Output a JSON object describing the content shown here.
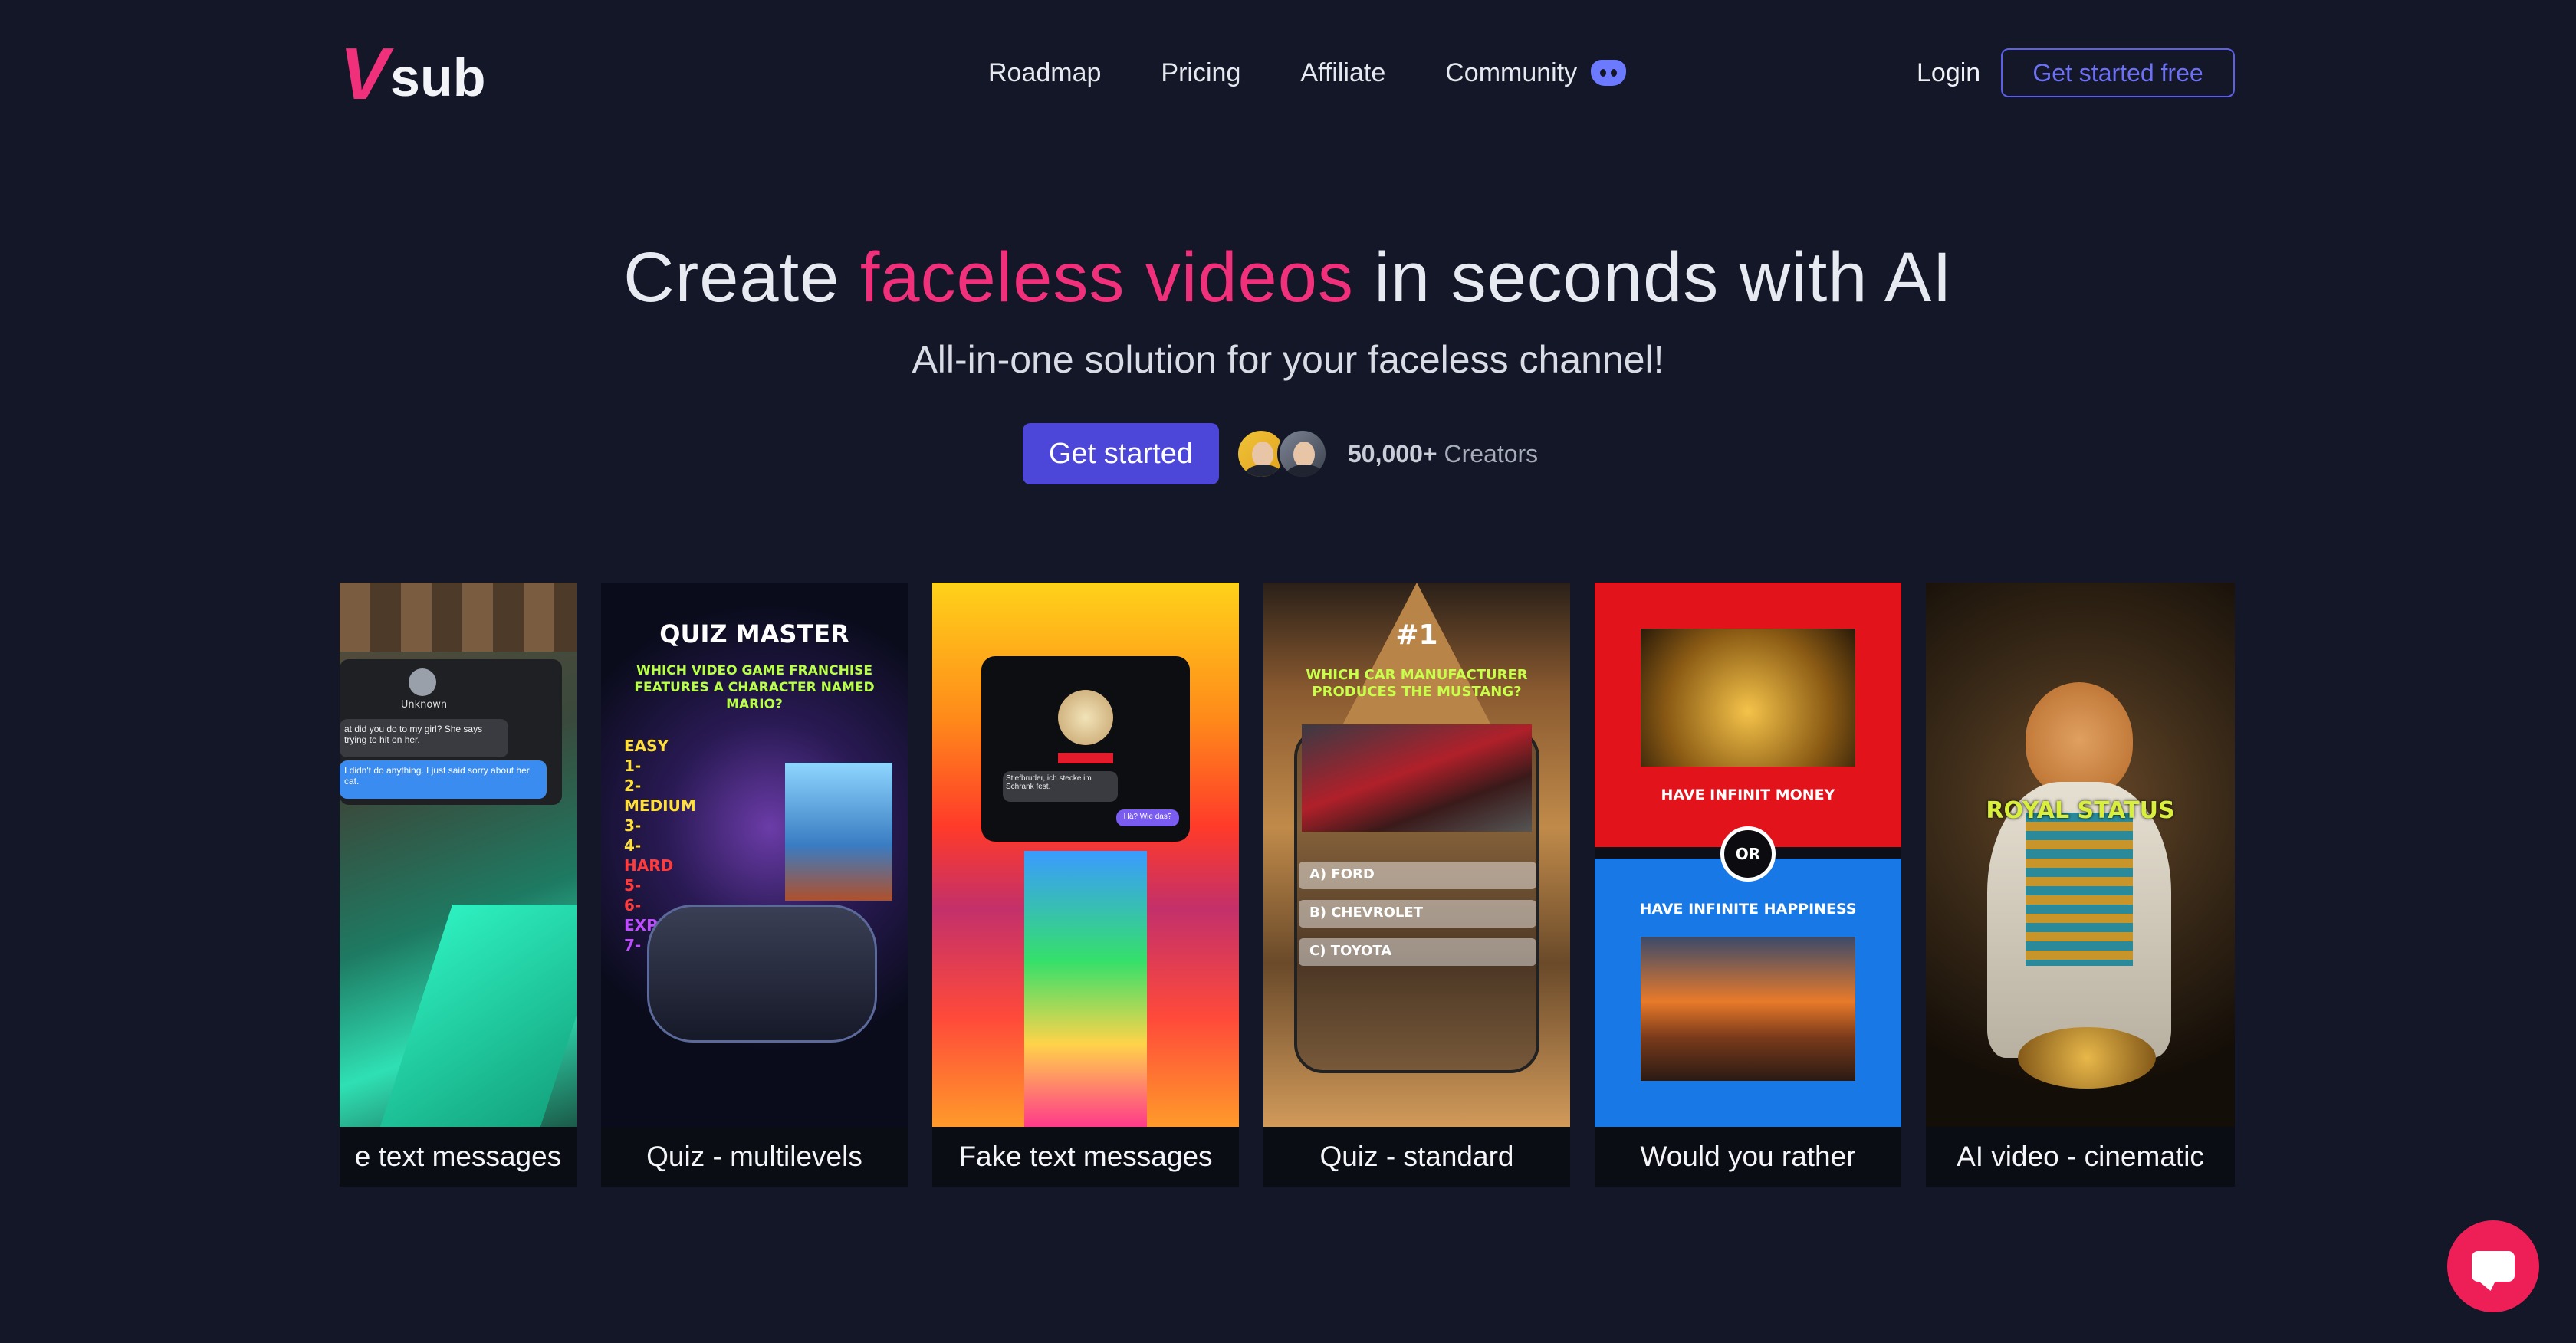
{
  "brand": {
    "logo_v": "V",
    "logo_rest": "sub"
  },
  "nav": {
    "items": [
      {
        "label": "Roadmap"
      },
      {
        "label": "Pricing"
      },
      {
        "label": "Affiliate"
      },
      {
        "label": "Community"
      }
    ],
    "login": "Login",
    "cta": "Get started free"
  },
  "hero": {
    "title_pre": "Create ",
    "title_highlight": "faceless videos",
    "title_post": " in seconds with AI",
    "subtitle": "All-in-one solution for your faceless channel!",
    "button": "Get started",
    "creators_count": "50,000+",
    "creators_label": "Creators"
  },
  "cards": [
    {
      "caption": "e text messages",
      "chat_name": "Unknown",
      "msg1": "at did you do to my girl? She says trying to hit on her.",
      "msg2": "I didn't do anything. I just said sorry about her cat."
    },
    {
      "caption": "Quiz - multilevels",
      "heading": "QUIZ MASTER",
      "question": "WHICH VIDEO GAME FRANCHISE FEATURES A CHARACTER NAMED MARIO?",
      "levels": [
        "EASY",
        "1-",
        "2-",
        "MEDIUM",
        "3-",
        "4-",
        "HARD",
        "5-",
        "6-",
        "EXPERT",
        "7-"
      ]
    },
    {
      "caption": "Fake text messages",
      "msg1": "Stiefbruder, ich stecke im Schrank fest.",
      "msg2": "Hä? Wie das?"
    },
    {
      "caption": "Quiz - standard",
      "number": "#1",
      "question": "WHICH CAR MANUFACTURER PRODUCES THE MUSTANG?",
      "options": [
        "A) FORD",
        "B) CHEVROLET",
        "C) TOYOTA"
      ]
    },
    {
      "caption": "Would you rather",
      "option_a": "HAVE INFINIT MONEY",
      "or": "OR",
      "option_b": "HAVE INFINITE HAPPINESS"
    },
    {
      "caption": "AI video - cinematic",
      "overlay": "ROYAL STATUS"
    }
  ],
  "colors": {
    "accent": "#f0307a",
    "primary": "#4c46d9",
    "background": "#131728",
    "chat": "#ee1f57"
  }
}
